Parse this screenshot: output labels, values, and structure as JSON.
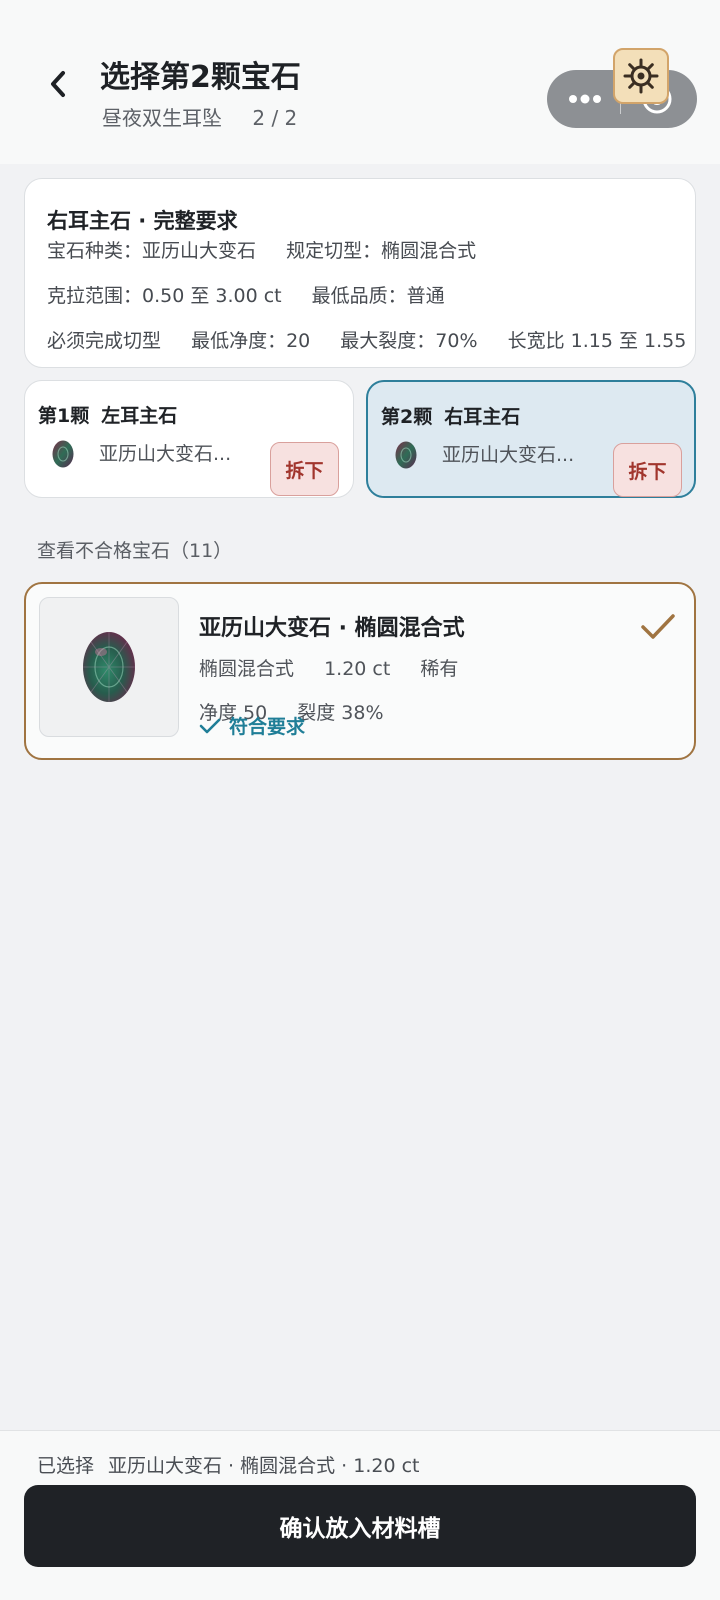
{
  "header": {
    "title": "选择第2颗宝石",
    "subtitle": "昼夜双生耳坠",
    "progress": "2 / 2"
  },
  "requirements": {
    "title": "右耳主石 · 完整要求",
    "gem_type": "宝石种类：亚历山大变石",
    "cut": "规定切型：椭圆混合式",
    "carat_range": "克拉范围：0.50 至 3.00 ct",
    "min_quality": "最低品质：普通",
    "must_cut": "必须完成切型",
    "min_clarity": "最低净度：20",
    "max_crack": "最大裂度：70%",
    "ratio": "长宽比 1.15 至 1.55"
  },
  "slots": [
    {
      "index": "第1颗",
      "name": "左耳主石",
      "gem": "亚历山大变石...",
      "detach_label": "拆下",
      "active": false
    },
    {
      "index": "第2颗",
      "name": "右耳主石",
      "gem": "亚历山大变石...",
      "detach_label": "拆下",
      "active": true
    }
  ],
  "unqualified_link": "查看不合格宝石（11）",
  "gem_option": {
    "name": "亚历山大变石 · 椭圆混合式",
    "cut": "椭圆混合式",
    "carat": "1.20 ct",
    "rarity": "稀有",
    "clarity": "净度 50",
    "crack": "裂度 38%",
    "status": "符合要求"
  },
  "bottom": {
    "selected_label": "已选择",
    "selected_value": "亚历山大变石 · 椭圆混合式 · 1.20 ct",
    "confirm_label": "确认放入材料槽"
  },
  "colors": {
    "accent_teal": "#2e7f9b",
    "accent_gold": "#a07441",
    "danger": "#a1352d",
    "button_dark": "#1f2226"
  }
}
